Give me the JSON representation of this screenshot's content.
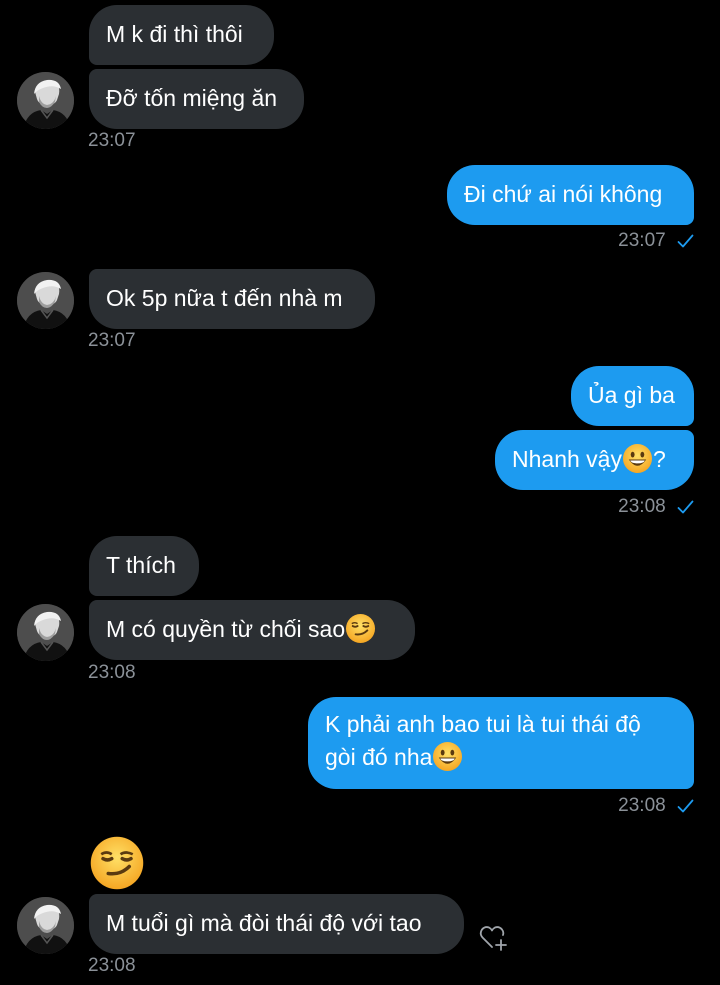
{
  "messages": [
    {
      "text": "M k đi thì thôi"
    },
    {
      "text": "Đỡ tốn miệng ăn"
    },
    {
      "time": "23:07"
    },
    {
      "text": "Đi chứ ai nói không"
    },
    {
      "time": "23:07"
    },
    {
      "text": "Ok 5p nữa t đến nhà m"
    },
    {
      "time": "23:07"
    },
    {
      "text": "Ủa gì ba"
    },
    {
      "text": "Nhanh vậy",
      "suffix": "?",
      "emoji": "grinning-face"
    },
    {
      "time": "23:08"
    },
    {
      "text": "T thích"
    },
    {
      "text": "M có quyền từ chối sao",
      "emoji": "smirking-face"
    },
    {
      "time": "23:08"
    },
    {
      "line1": "K phải anh bao tui là tui thái độ",
      "line2": "gòi đó nha",
      "emoji": "grinning-face"
    },
    {
      "time": "23:08"
    },
    {
      "emoji": "smirking-face"
    },
    {
      "text": "M tuổi gì mà đòi thái độ với tao"
    },
    {
      "time": "23:08"
    }
  ],
  "colors": {
    "background": "#000000",
    "incoming_bubble": "#2b2f33",
    "outgoing_bubble": "#1d9bf0",
    "timestamp": "#8b9198",
    "read_check": "#1d9bf0"
  }
}
